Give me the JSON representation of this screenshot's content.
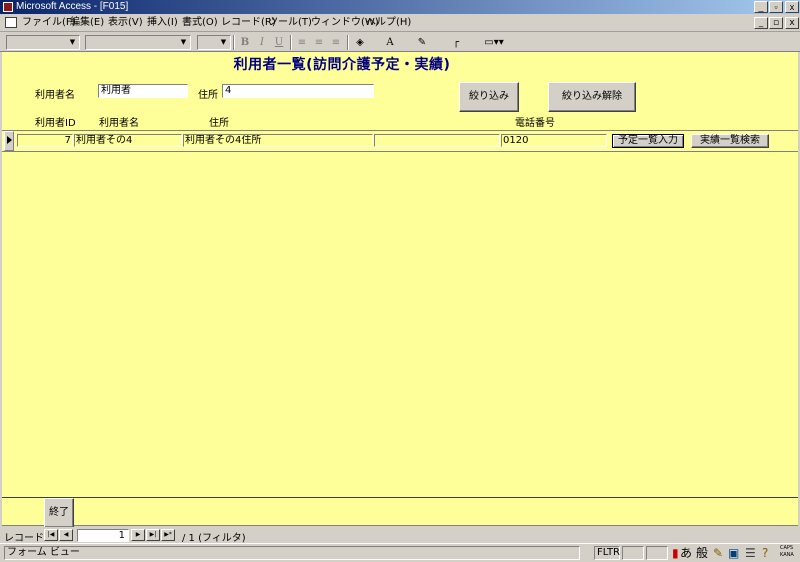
{
  "window": {
    "title": "Microsoft Access - [F015]",
    "min": "_",
    "max": "▫",
    "close": "x"
  },
  "menu": [
    "ファイル(F)",
    "編集(E)",
    "表示(V)",
    "挿入(I)",
    "書式(O)",
    "レコード(R)",
    "ツール(T)",
    "ウィンドウ(W)",
    "ヘルプ(H)"
  ],
  "toolbar": {
    "bold": "B",
    "italic": "I",
    "underline": "U"
  },
  "form": {
    "title": "利用者一覧(訪問介護予定・実績)",
    "filter": {
      "name_label": "利用者名",
      "name_value": "利用者",
      "address_label": "住所",
      "address_value": "4",
      "apply_button": "絞り込み",
      "clear_button": "絞り込み解除"
    },
    "headers": {
      "id": "利用者ID",
      "name": "利用者名",
      "address": "住所",
      "phone": "電話番号"
    },
    "row": {
      "id": "7",
      "name": "利用者その4",
      "address": "利用者その4住所",
      "extra": "",
      "phone": "0120",
      "schedule_button": "予定一覧入力",
      "results_button": "実績一覧検索"
    },
    "exit_button": "終了"
  },
  "nav": {
    "label": "レコード:",
    "current": "1",
    "total_text": "/ 1 (フィルタ)"
  },
  "status": {
    "view": "フォーム ビュー",
    "fltr": "FLTR",
    "ime_a": "あ",
    "ime_mode": "般",
    "caps": "CAPS",
    "kana": "KANA"
  },
  "colors": {
    "form_bg": "#ffff99",
    "title_color": "#000080"
  }
}
